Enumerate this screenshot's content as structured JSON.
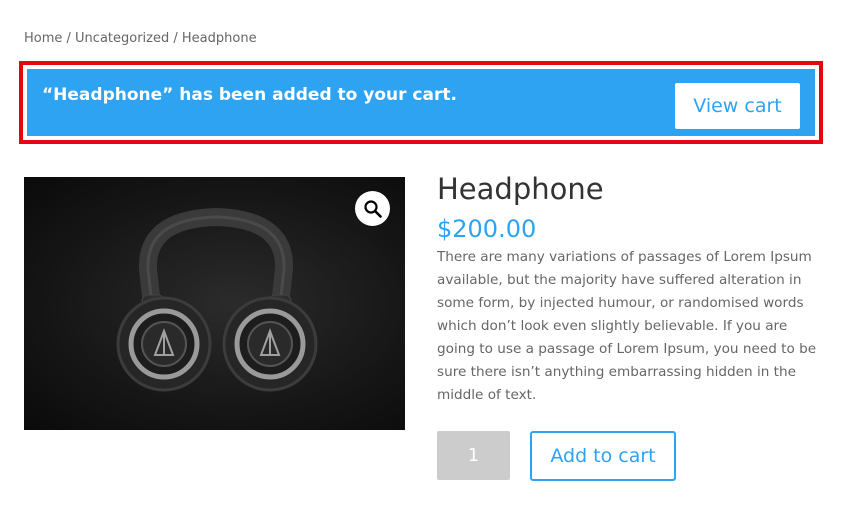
{
  "breadcrumb": {
    "items": [
      "Home",
      "Uncategorized",
      "Headphone"
    ],
    "separator": " / "
  },
  "notice": {
    "message": "“Headphone” has been added to your cart.",
    "button_label": "View cart",
    "background": "#2ea3f2",
    "highlight_border": "#e30613"
  },
  "product": {
    "image_subject": "headphone-image",
    "zoom_icon": "magnifier-icon",
    "title": "Headphone",
    "price": "$200.00",
    "description": "There are many variations of passages of Lorem Ipsum available, but the majority have suffered alteration in some form, by injected humour, or randomised words which don’t look even slightly believable. If you are going to use a passage of Lorem Ipsum, you need to be sure there isn’t anything embarrassing hidden in the middle of text.",
    "quantity": "1",
    "add_to_cart_label": "Add to cart"
  },
  "colors": {
    "accent": "#2ea3f2",
    "text": "#666666",
    "heading": "#333333"
  }
}
